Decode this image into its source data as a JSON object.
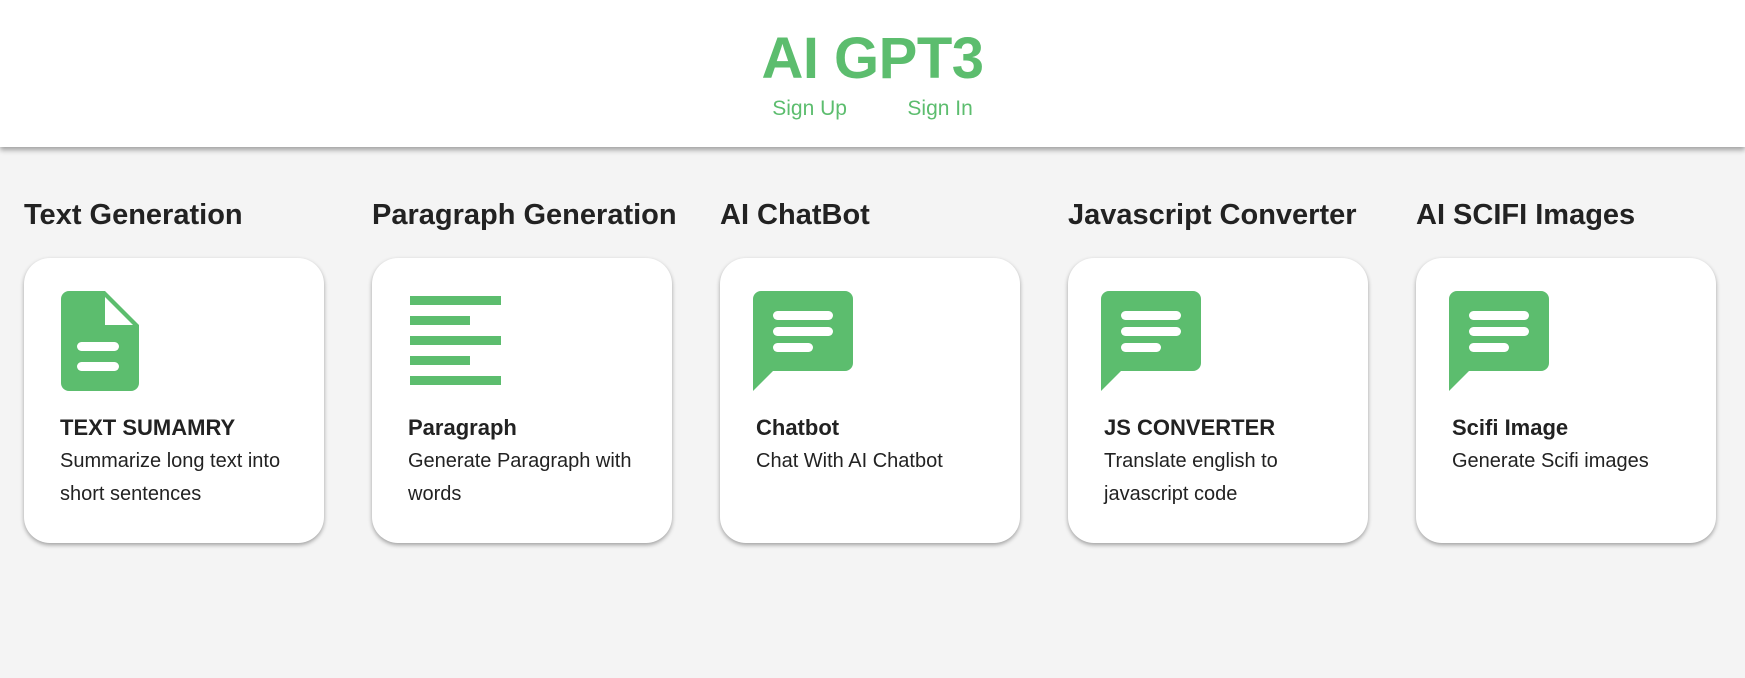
{
  "header": {
    "brand": "AI GPT3",
    "nav": [
      {
        "label": "Sign Up"
      },
      {
        "label": "Sign In"
      }
    ]
  },
  "colors": {
    "accent": "#5cbd6e",
    "background": "#f4f4f4",
    "card": "#ffffff",
    "text": "#222222"
  },
  "tools": [
    {
      "heading": "Text Generation",
      "icon": "document-icon",
      "title": "TEXT SUMAMRY",
      "description": "Summarize long text into short sentences"
    },
    {
      "heading": "Paragraph Generation",
      "icon": "paragraph-lines-icon",
      "title": "Paragraph",
      "description": "Generate Paragraph with words"
    },
    {
      "heading": "AI ChatBot",
      "icon": "chat-bubble-icon",
      "title": "Chatbot",
      "description": "Chat With AI Chatbot"
    },
    {
      "heading": "Javascript Converter",
      "icon": "chat-bubble-icon",
      "title": "JS CONVERTER",
      "description": "Translate english to javascript code"
    },
    {
      "heading": "AI SCIFI Images",
      "icon": "chat-bubble-icon",
      "title": "Scifi Image",
      "description": "Generate Scifi images"
    }
  ]
}
